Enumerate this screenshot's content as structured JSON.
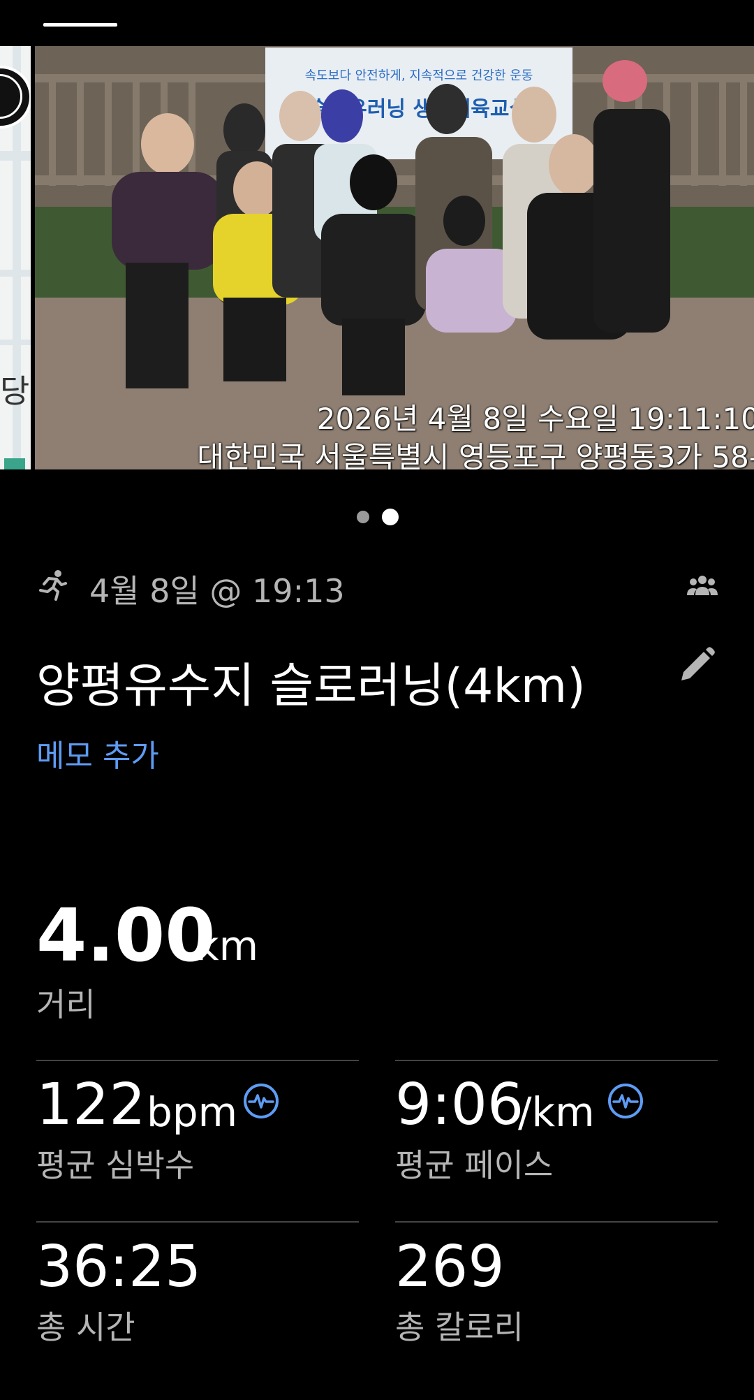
{
  "photo": {
    "banner_line1": "속도보다 안전하게, 지속적으로 건강한 운동",
    "banner_line2": "슬로우러닝 생활체육교실",
    "stamp_datetime": "2026년 4월 8일 수요일 19:11:10",
    "stamp_address": "대한민국 서울특별시 영등포구 양평동3가 58-"
  },
  "map": {
    "label": "당"
  },
  "pager": {
    "count": 2,
    "active_index": 1
  },
  "activity": {
    "date": "4월 8일 @ 19:13",
    "title": "양평유수지 슬로러닝(4km)",
    "memo_link": "메모 추가"
  },
  "stats": {
    "distance": {
      "value": "4.00",
      "unit": "km",
      "label": "거리"
    },
    "heart_rate": {
      "value": "122",
      "unit": "bpm",
      "label": "평균 심박수"
    },
    "pace": {
      "value": "9:06",
      "unit": "/km",
      "label": "평균 페이스"
    },
    "time": {
      "value": "36:25",
      "label": "총 시간"
    },
    "calories": {
      "value": "269",
      "label": "총 칼로리"
    }
  },
  "colors": {
    "background": "#000000",
    "accent": "#5e9cf4",
    "secondary_text": "#b5b5b5",
    "divider": "#444444"
  },
  "icons": {
    "activity": "runner-icon",
    "group": "group-icon",
    "edit": "pencil-icon",
    "metric": "heart-rate-icon"
  }
}
